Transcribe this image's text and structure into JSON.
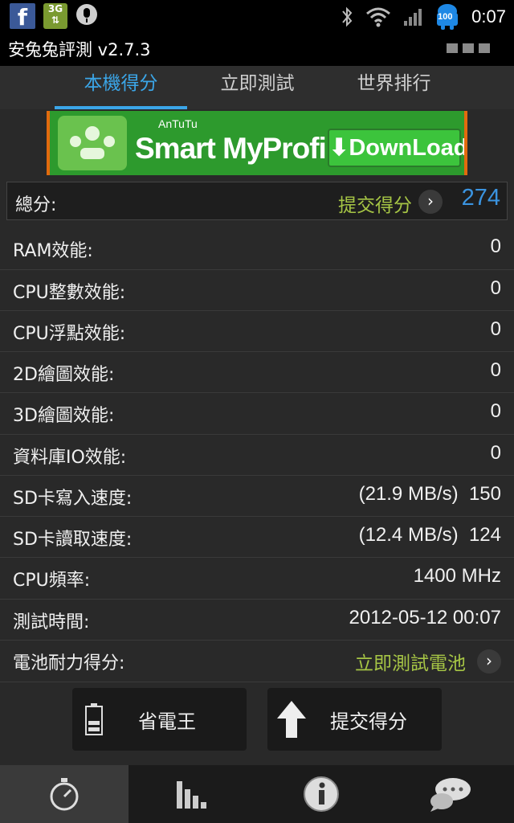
{
  "status_bar": {
    "left_icons": [
      "facebook-icon",
      "3g-data-icon",
      "microphone-icon"
    ],
    "fb_letter": "f",
    "net_label": "3G",
    "battery_level": "100",
    "time": "0:07"
  },
  "app": {
    "title": "安兔兔評測 v2.7.3"
  },
  "tabs": [
    {
      "label": "本機得分",
      "active": true
    },
    {
      "label": "立即測試",
      "active": false
    },
    {
      "label": "世界排行",
      "active": false
    }
  ],
  "banner": {
    "brand": "AnTuTu",
    "title": "Smart MyProfile",
    "button": "DownLoad"
  },
  "total": {
    "label": "總分:",
    "submit_label": "提交得分",
    "score": "274"
  },
  "rows": [
    {
      "label": "RAM效能:",
      "value": "0"
    },
    {
      "label": "CPU整數效能:",
      "value": "0"
    },
    {
      "label": "CPU浮點效能:",
      "value": "0"
    },
    {
      "label": "2D繪圖效能:",
      "value": "0"
    },
    {
      "label": "3D繪圖效能:",
      "value": "0"
    },
    {
      "label": "資料庫IO效能:",
      "value": "0"
    },
    {
      "label": "SD卡寫入速度:",
      "value": "(21.9 MB/s)  150"
    },
    {
      "label": "SD卡讀取速度:",
      "value": "(12.4 MB/s)  124"
    },
    {
      "label": "CPU頻率:",
      "value": "1400 MHz"
    },
    {
      "label": "測試時間:",
      "value": "2012-05-12 00:07"
    }
  ],
  "battery_row": {
    "label": "電池耐力得分:",
    "link": "立即測試電池"
  },
  "buttons": {
    "power_saver": "省電王",
    "submit_score": "提交得分"
  },
  "bottom_nav": [
    "stopwatch-icon",
    "bar-chart-icon",
    "info-icon",
    "chat-icon"
  ],
  "colors": {
    "accent_blue": "#3ba6e8",
    "link_green": "#a6c545",
    "background": "#292929"
  }
}
